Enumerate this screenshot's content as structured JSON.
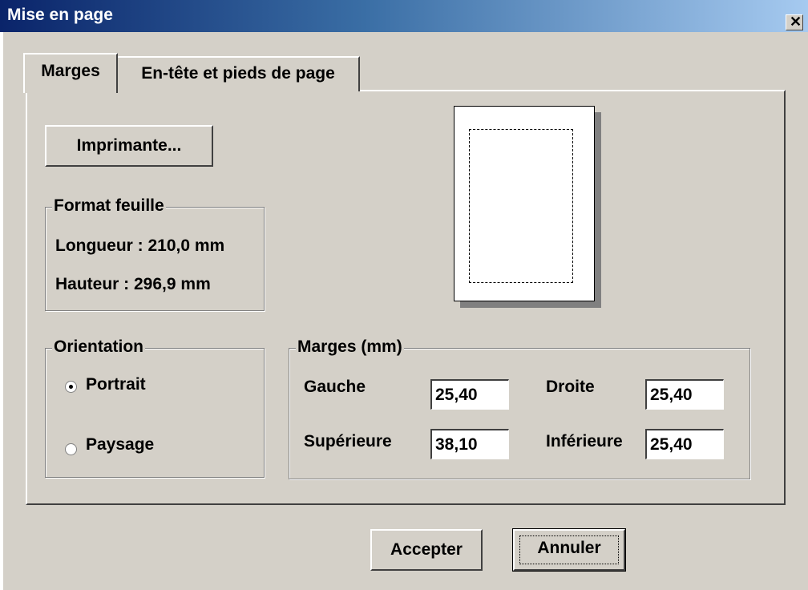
{
  "window": {
    "title": "Mise en page",
    "close_glyph": "✕"
  },
  "tabs": [
    {
      "label": "Marges",
      "active": true
    },
    {
      "label": "En-tête et pieds de page",
      "active": false
    }
  ],
  "printer_button": "Imprimante...",
  "format": {
    "legend": "Format feuille",
    "length": "Longueur : 210,0 mm",
    "height": "Hauteur : 296,9 mm"
  },
  "orientation": {
    "legend": "Orientation",
    "options": [
      {
        "label": "Portrait",
        "selected": true
      },
      {
        "label": "Paysage",
        "selected": false
      }
    ]
  },
  "margins": {
    "legend": "Marges (mm)",
    "left": {
      "label": "Gauche",
      "value": "25,40"
    },
    "right": {
      "label": "Droite",
      "value": "25,40"
    },
    "top": {
      "label": "Supérieure",
      "value": "38,10"
    },
    "bottom": {
      "label": "Inférieure",
      "value": "25,40"
    }
  },
  "buttons": {
    "accept": "Accepter",
    "cancel": "Annuler"
  },
  "colors": {
    "dialog_bg": "#d4d0c8",
    "titlebar_start": "#0a246a",
    "titlebar_end": "#a6caf0"
  }
}
